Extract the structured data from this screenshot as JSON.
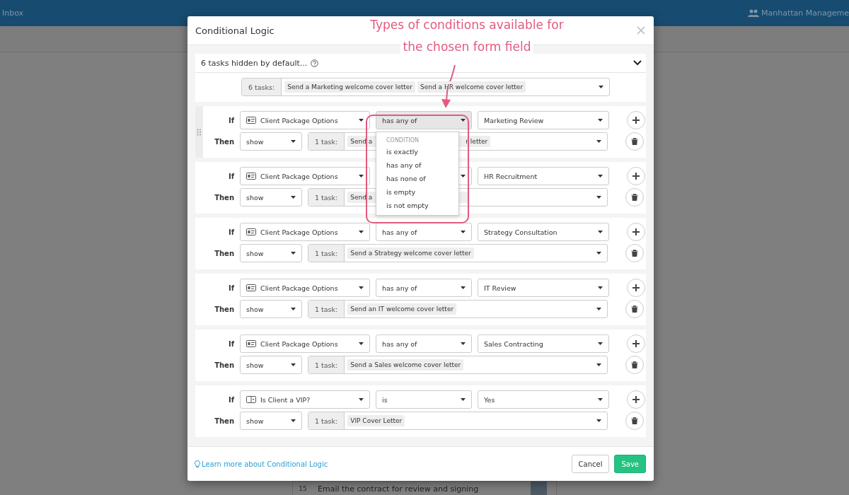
{
  "app_bar": {
    "left_link": "Inbox",
    "account": "Manhattan Manageme"
  },
  "background_row": {
    "number": "15",
    "text": "Email the contract for review and signing"
  },
  "modal": {
    "title": "Conditional Logic",
    "hidden_panel": {
      "summary": "6 tasks hidden by default...",
      "expanded": true,
      "task_count": "6 tasks:",
      "tasks": [
        "Send a Marketing welcome cover letter",
        "Send a HR welcome cover letter"
      ]
    },
    "rules": [
      {
        "if_label": "If",
        "then_label": "Then",
        "drag_handle": true,
        "field": {
          "kind": "choice",
          "text": "Client Package Options"
        },
        "condition": {
          "text": "has any of",
          "open": true
        },
        "value": "Marketing Review",
        "action": "show",
        "task_count": "1 task:",
        "task_fragments": [
          "Send a",
          "r letter"
        ],
        "menu": {
          "header": "CONDITION",
          "options": [
            "is exactly",
            "has any of",
            "has none of",
            "is empty",
            "is not empty"
          ]
        }
      },
      {
        "if_label": "If",
        "then_label": "Then",
        "drag_handle": false,
        "field": {
          "kind": "choice",
          "text": "Client Package Options"
        },
        "condition": {
          "open": false
        },
        "value": "HR Recruitment",
        "action": "show",
        "task_count": "1 task:",
        "task_fragments": [
          "Send a"
        ]
      },
      {
        "if_label": "If",
        "then_label": "Then",
        "drag_handle": false,
        "field": {
          "kind": "choice",
          "text": "Client Package Options"
        },
        "condition": {
          "text": "has any of",
          "open": false
        },
        "value": "Strategy Consultation",
        "action": "show",
        "task_count": "1 task:",
        "task_fragments": [
          "Send a Strategy welcome cover letter"
        ]
      },
      {
        "if_label": "If",
        "then_label": "Then",
        "drag_handle": false,
        "field": {
          "kind": "choice",
          "text": "Client Package Options"
        },
        "condition": {
          "text": "has any of",
          "open": false
        },
        "value": "IT Review",
        "action": "show",
        "task_count": "1 task:",
        "task_fragments": [
          "Send an IT welcome cover letter"
        ]
      },
      {
        "if_label": "If",
        "then_label": "Then",
        "drag_handle": false,
        "field": {
          "kind": "choice",
          "text": "Client Package Options"
        },
        "condition": {
          "text": "has any of",
          "open": false
        },
        "value": "Sales Contracting",
        "action": "show",
        "task_count": "1 task:",
        "task_fragments": [
          "Send a Sales welcome cover letter"
        ]
      },
      {
        "if_label": "If",
        "then_label": "Then",
        "drag_handle": false,
        "field": {
          "kind": "yesno",
          "text": "Is Client a VIP?"
        },
        "condition": {
          "text": "is",
          "open": false
        },
        "value": "Yes",
        "action": "show",
        "task_count": "1 task:",
        "task_fragments": [
          "VIP Cover Letter"
        ]
      }
    ],
    "footer": {
      "help_link": "Learn more about Conditional Logic",
      "buttons": [
        {
          "kind": "secondary",
          "label": "Cancel"
        },
        {
          "kind": "primary",
          "label": "Save"
        }
      ]
    }
  },
  "annotation": {
    "lines": [
      "Types of conditions available for",
      "the chosen form field"
    ]
  }
}
